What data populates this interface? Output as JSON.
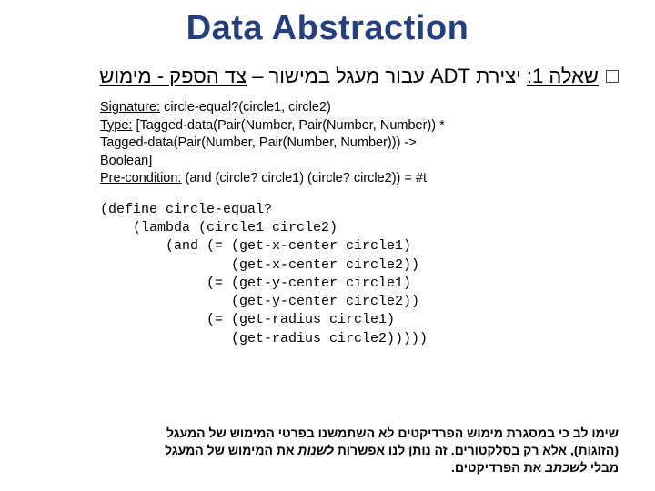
{
  "title": "Data Abstraction",
  "question": {
    "prefix": "שאלה 1:",
    "mid1": "  יצירת ",
    "adt": "ADT",
    "mid2": " עבור מעגל במישור – ",
    "suffix": "צד הספק - מימוש"
  },
  "signature": {
    "sig_label": "Signature:",
    "sig_text": " circle-equal?(circle1, circle2)",
    "type_label": "Type:",
    "type_text": " [Tagged-data(Pair(Number, Pair(Number, Number)) *",
    "type_text2": " Tagged-data(Pair(Number, Pair(Number, Number))) ->",
    "type_text3": "Boolean]",
    "pre_label": "Pre-condition:",
    "pre_text": " (and (circle? circle1) (circle? circle2)) = #t"
  },
  "code": "(define circle-equal?\n    (lambda (circle1 circle2)\n        (and (= (get-x-center circle1)\n                (get-x-center circle2))\n             (= (get-y-center circle1)\n                (get-y-center circle2))\n             (= (get-radius circle1)\n                (get-radius circle2)))))",
  "footnote": {
    "line1": "שימו לב כי במסגרת מימוש הפרדיקטים לא השתמשנו בפרטי המימוש של המעגל",
    "line2a": "(הזוגות), אלא רק בסלקטורים. זה נותן לנו אפשרות ",
    "line2b": "לשנות",
    "line2c": " את המימוש של המעגל",
    "line3a": "מבלי ",
    "line3b": "לשכתב",
    "line3c": " את הפרדיקטים."
  }
}
